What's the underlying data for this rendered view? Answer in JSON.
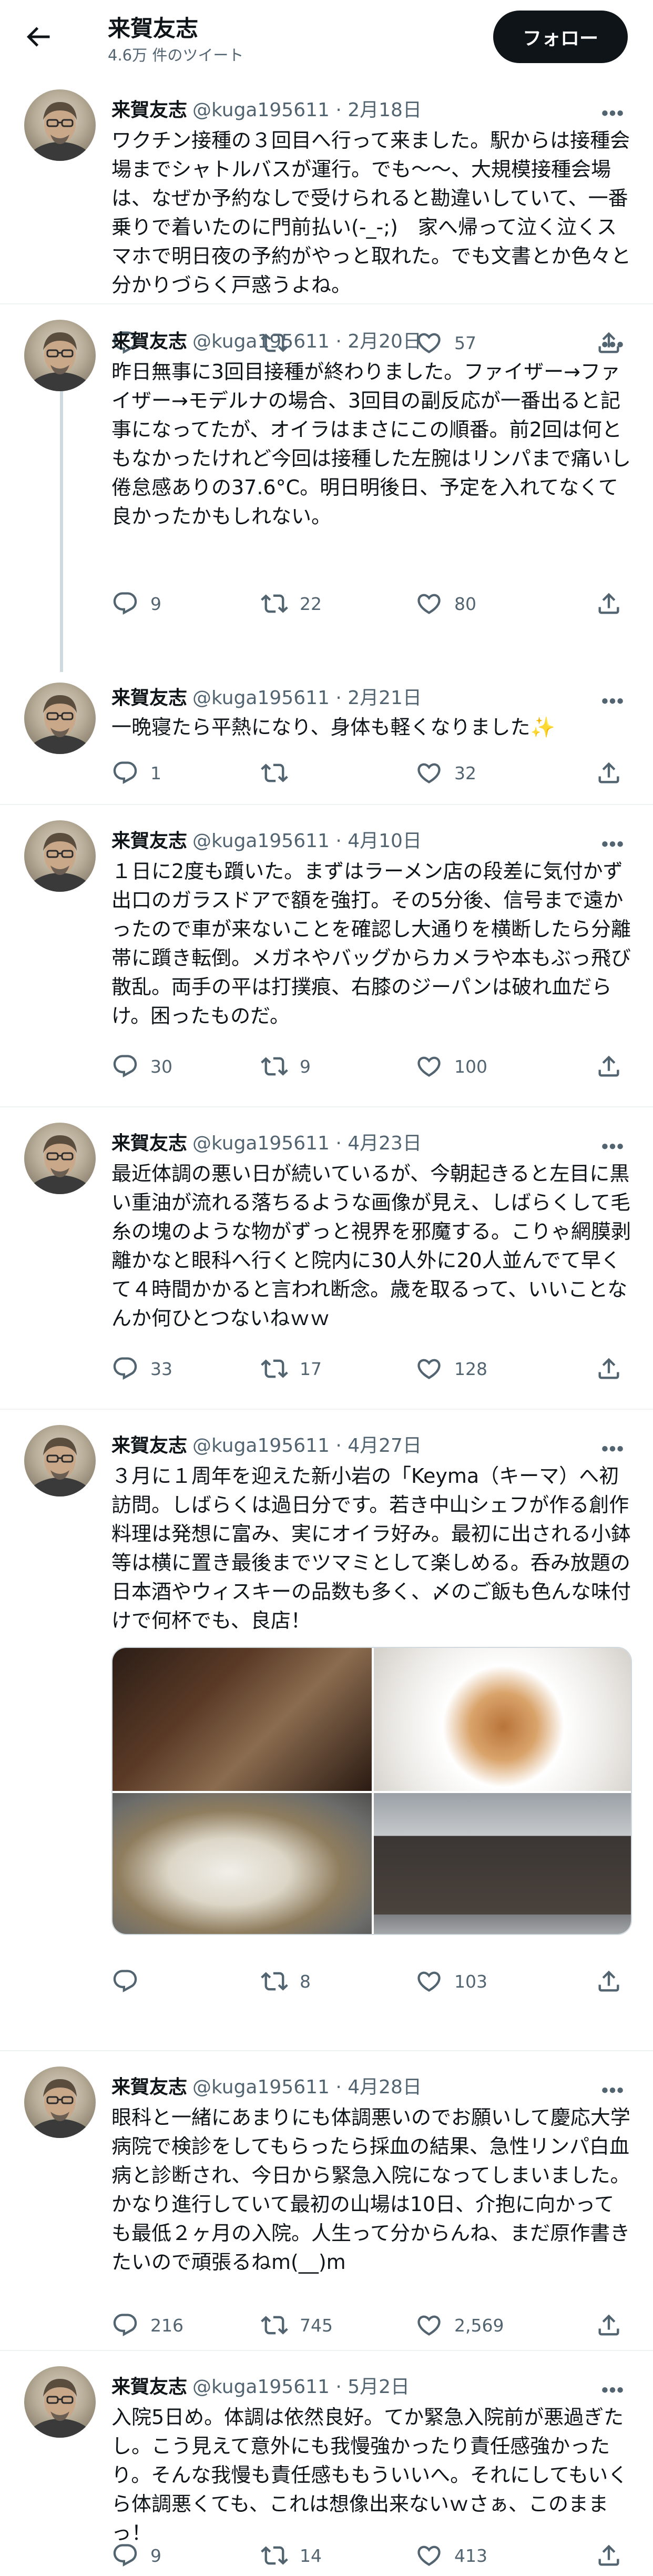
{
  "header": {
    "name": "来賀友志",
    "tweet_count": "4.6万 件のツイート",
    "follow_label": "フォロー"
  },
  "tweets": [
    {
      "name": "来賀友志",
      "handle": "@kuga195611 · 2月18日",
      "text": "ワクチン接種の３回目へ行って来ました。駅からは接種会場までシャトルバスが運行。でも〜〜、大規模接種会場は、なぜか予約なしで受けられると勘違いしていて、一番乗りで着いたのに門前払い(-_-;)　家へ帰って泣く泣くスマホで明日夜の予約がやっと取れた。でも文書とか色々と分かりづらく戸惑うよね。",
      "replies": "",
      "retweets": "",
      "likes": "57"
    },
    {
      "name": "来賀友志",
      "handle": "@kuga195611 · 2月20日",
      "text": "昨日無事に3回目接種が終わりました。ファイザー→ファイザー→モデルナの場合、3回目の副反応が一番出ると記事になってたが、オイラはまさにこの順番。前2回は何ともなかったけれど今回は接種した左腕はリンパまで痛いし倦怠感ありの37.6°C。明日明後日、予定を入れてなくて良かったかもしれない。",
      "replies": "9",
      "retweets": "22",
      "likes": "80"
    },
    {
      "name": "来賀友志",
      "handle": "@kuga195611 · 2月21日",
      "text": "一晩寝たら平熱になり、身体も軽くなりました✨",
      "replies": "1",
      "retweets": "",
      "likes": "32"
    },
    {
      "name": "来賀友志",
      "handle": "@kuga195611 · 4月10日",
      "text": "１日に2度も躓いた。まずはラーメン店の段差に気付かず出口のガラスドアで額を強打。その5分後、信号まで遠かったので車が来ないことを確認し大通りを横断したら分離帯に躓き転倒。メガネやバッグからカメラや本もぶっ飛び散乱。両手の平は打撲痕、右膝のジーパンは破れ血だらけ。困ったものだ。",
      "replies": "30",
      "retweets": "9",
      "likes": "100"
    },
    {
      "name": "来賀友志",
      "handle": "@kuga195611 · 4月23日",
      "text": "最近体調の悪い日が続いているが、今朝起きると左目に黒い重油が流れる落ちるような画像が見え、しばらくして毛糸の塊のような物がずっと視界を邪魔する。こりゃ網膜剥離かなと眼科へ行くと院内に30人外に20人並んでて早くて４時間かかると言われ断念。歳を取るって、いいことなんか何ひとつないねｗｗ",
      "replies": "33",
      "retweets": "17",
      "likes": "128"
    },
    {
      "name": "来賀友志",
      "handle": "@kuga195611 · 4月27日",
      "text": "３月に１周年を迎えた新小岩の「Keyma（キーマ）へ初訪問。しばらくは過日分です。若き中山シェフが作る創作料理は発想に富み、実にオイラ好み。最初に出される小鉢等は横に置き最後までツマミとして楽しめる。呑み放題の日本酒やウィスキーの品数も多く、〆のご飯も色んな味付けで何杯でも、良店！",
      "replies": "",
      "retweets": "8",
      "likes": "103"
    },
    {
      "name": "来賀友志",
      "handle": "@kuga195611 · 4月28日",
      "text": "眼科と一緒にあまりにも体調悪いのでお願いして慶応大学病院で検診をしてもらったら採血の結果、急性リンパ白血病と診断され、今日から緊急入院になってしまいました。かなり進行していて最初の山場は10日、介抱に向かっても最低２ヶ月の入院。人生って分からんね、まだ原作書きたいので頑張るねm(__)m",
      "replies": "216",
      "retweets": "745",
      "likes": "2,569"
    },
    {
      "name": "来賀友志",
      "handle": "@kuga195611 · 5月2日",
      "text": "入院5日め。体調は依然良好。てか緊急入院前が悪過ぎたし。こう見えて意外にも我慢強かったり責任感強かったり。そんな我慢も責任感ももういいへ。それにしてもいくら体調悪くても、これは想像出来ないｗさぁ、このままっ！",
      "replies": "9",
      "retweets": "14",
      "likes": "413"
    }
  ],
  "icons": {
    "back": "arrow-left-icon",
    "more": "more-horizontal-icon",
    "reply": "reply-icon",
    "retweet": "retweet-icon",
    "like": "heart-icon",
    "share": "share-icon"
  },
  "colors": {
    "text": "#0f1419",
    "secondary": "#536471",
    "divider": "#eff3f4",
    "follow_bg": "#0f1419"
  }
}
